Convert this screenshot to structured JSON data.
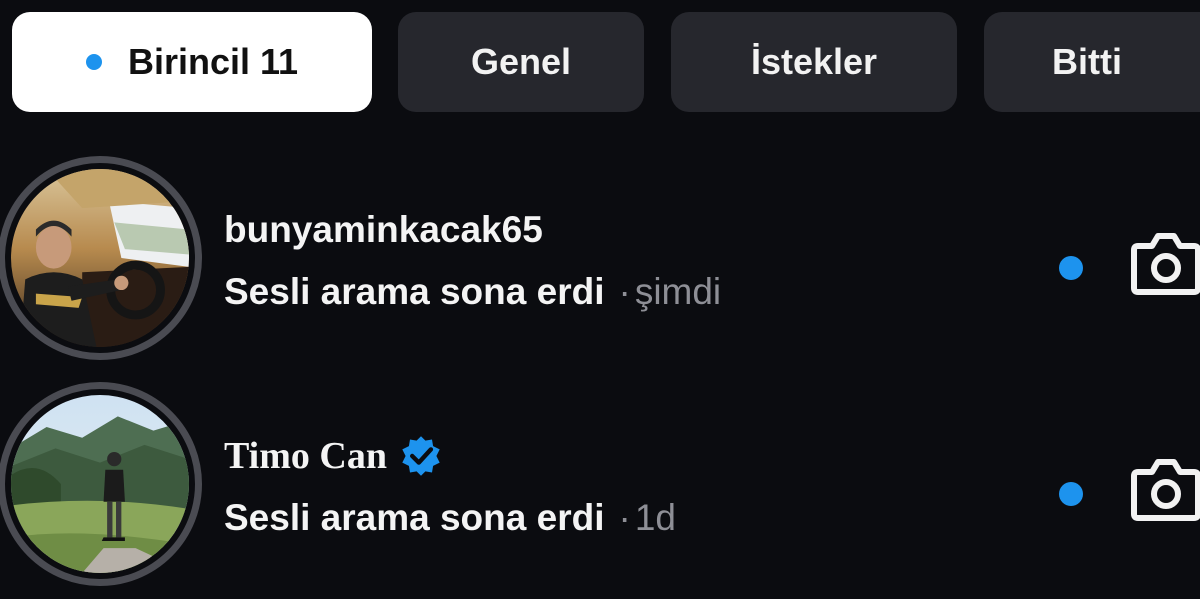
{
  "tabs": {
    "primary": {
      "label": "Birincil 11",
      "dot_color": "#1d93ee"
    },
    "general": {
      "label": "Genel"
    },
    "requests": {
      "label": "İstekler"
    },
    "done": {
      "label": "Bitti"
    }
  },
  "threads": [
    {
      "username": "bunyaminkacak65",
      "verified": false,
      "message": "Sesli arama sona erdi",
      "separator": "·",
      "time": "şimdi",
      "unread": true,
      "avatar_icon": "profile-photo-car"
    },
    {
      "username": "Timo Can",
      "verified": true,
      "message": "Sesli arama sona erdi",
      "separator": "·",
      "time": "1d",
      "unread": true,
      "avatar_icon": "profile-photo-mountain"
    }
  ],
  "colors": {
    "background": "#0b0c10",
    "tab_inactive": "#26272d",
    "tab_active": "#ffffff",
    "accent_blue": "#1d93ee",
    "secondary_text": "#8e8f96"
  }
}
